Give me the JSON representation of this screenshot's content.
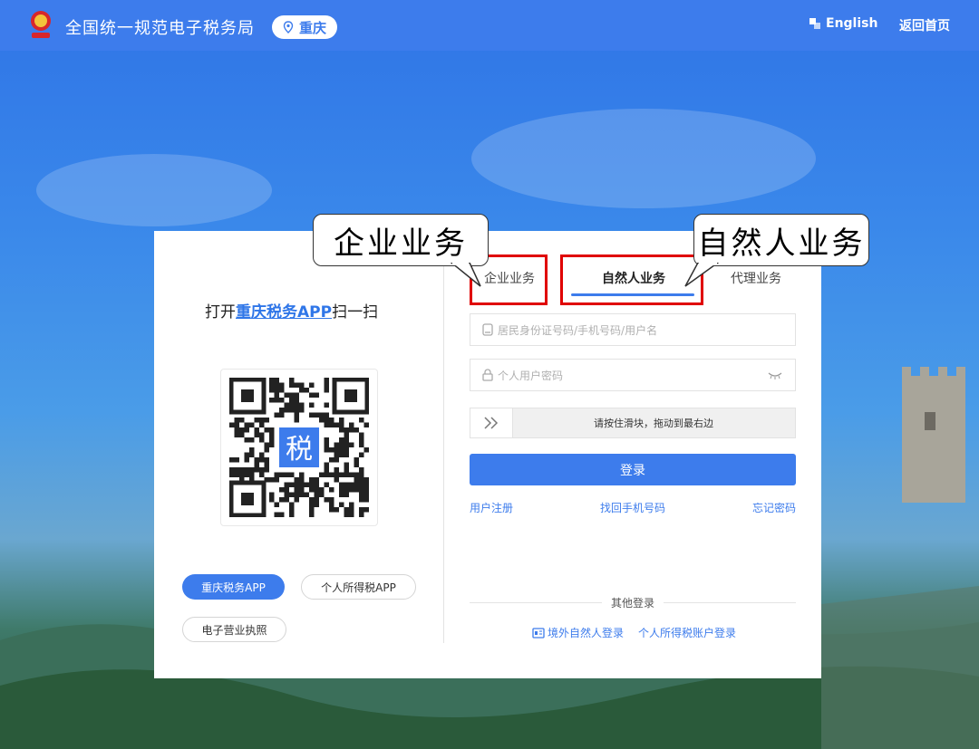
{
  "header": {
    "site_title": "全国统一规范电子税务局",
    "region": "重庆",
    "english": "English",
    "home": "返回首页"
  },
  "qr_panel": {
    "scan_prefix": "打开",
    "scan_app": "重庆税务APP",
    "scan_suffix": "扫一扫",
    "qr_center_char": "税",
    "buttons": [
      "重庆税务APP",
      "个人所得税APP",
      "电子营业执照"
    ]
  },
  "tabs": {
    "enterprise": "企业业务",
    "natural": "自然人业务",
    "agent": "代理业务"
  },
  "callouts": {
    "enterprise": "企业业务",
    "natural": "自然人业务"
  },
  "form": {
    "username_placeholder": "居民身份证号码/手机号码/用户名",
    "password_placeholder": "个人用户密码",
    "slider_hint": "请按住滑块，拖动到最右边",
    "login": "登录"
  },
  "links": {
    "register": "用户注册",
    "recover_phone": "找回手机号码",
    "forgot_password": "忘记密码"
  },
  "other_login": {
    "label": "其他登录",
    "foreign": "境外自然人登录",
    "tax_account": "个人所得税账户登录"
  },
  "colors": {
    "primary": "#3d7cec",
    "highlight_box": "#e00000"
  }
}
